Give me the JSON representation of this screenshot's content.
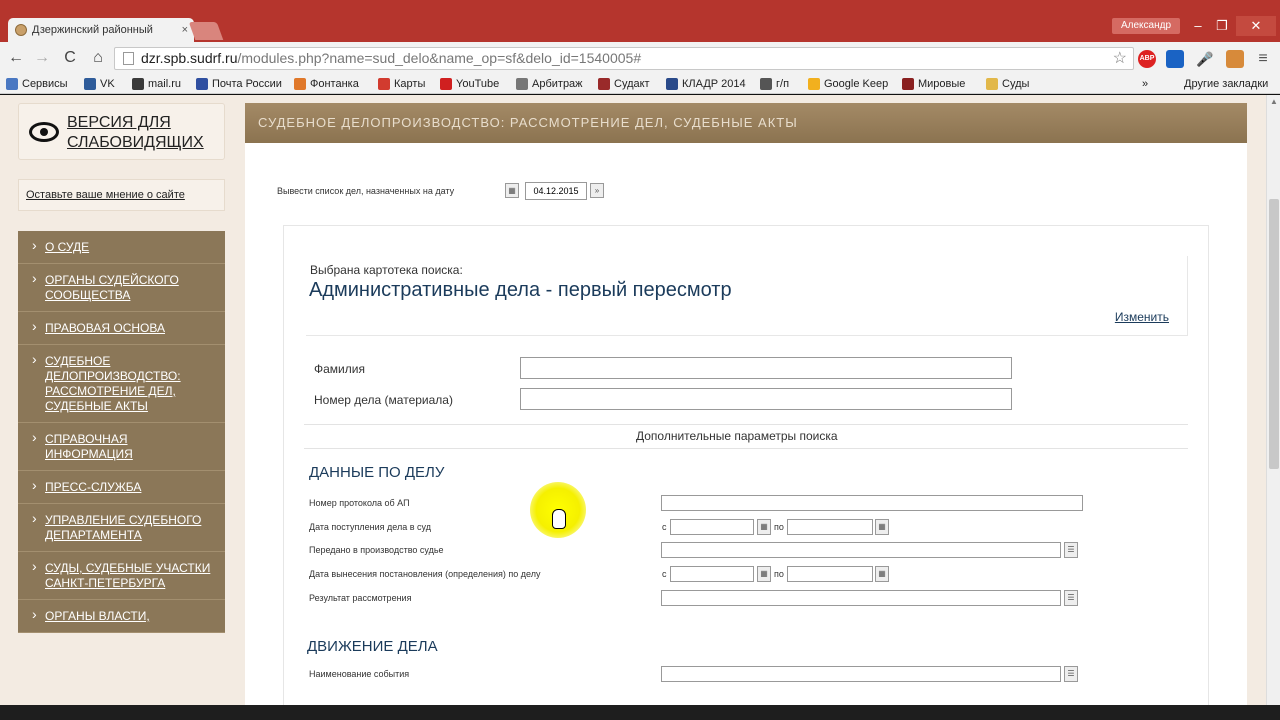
{
  "browser": {
    "tab_title": "Дзержинский районный",
    "tab_close": "×",
    "user_name": "Александр",
    "win_min": "–",
    "win_max": "❐",
    "win_close": "✕",
    "url_host": "dzr.spb.sudrf.ru",
    "url_path": "/modules.php?name=sud_delo&name_op=sf&delo_id=1540005#",
    "abp_label": "ABP",
    "nav_back": "←",
    "nav_forward": "→",
    "nav_reload": "C",
    "nav_home": "⌂",
    "star": "☆",
    "mic": "🎤",
    "menu": "≡"
  },
  "bookmarks": {
    "items": [
      "Сервисы",
      "VK",
      "mail.ru",
      "Почта России",
      "Фонтанка",
      "Карты",
      "YouTube",
      "Арбитраж",
      "Судакт",
      "КЛАДР 2014",
      "г/п",
      "Google Keep",
      "Мировые",
      "Суды"
    ],
    "overflow": "»",
    "other": "Другие закладки",
    "colors": [
      "#4a78c2",
      "#2f5c9a",
      "#3a3a3a",
      "#2f4fa0",
      "#e0782a",
      "#d23b2f",
      "#d02020",
      "#777777",
      "#9a2a2a",
      "#2a4a8a",
      "#555555",
      "#f2b01e",
      "#8a2020",
      "#e2b84a"
    ]
  },
  "sidebar": {
    "vision_label": "ВЕРСИЯ ДЛЯ СЛАБОВИДЯЩИХ",
    "opinion_link": "Оставьте ваше мнение о сайте",
    "menu": [
      "О СУДЕ",
      "ОРГАНЫ СУДЕЙСКОГО СООБЩЕСТВА",
      "ПРАВОВАЯ ОСНОВА",
      "СУДЕБНОЕ ДЕЛОПРОИЗВОДСТВО: РАССМОТРЕНИЕ ДЕЛ, СУДЕБНЫЕ АКТЫ",
      "СПРАВОЧНАЯ ИНФОРМАЦИЯ",
      "ПРЕСС-СЛУЖБА",
      "УПРАВЛЕНИЕ СУДЕБНОГО ДЕПАРТАМЕНТА",
      "СУДЫ, СУДЕБНЫЕ УЧАСТКИ САНКТ-ПЕТЕРБУРГА",
      "ОРГАНЫ ВЛАСТИ,"
    ]
  },
  "header": {
    "title": "СУДЕБНОЕ ДЕЛОПРОИЗВОДСТВО: РАССМОТРЕНИЕ ДЕЛ, СУДЕБНЫЕ АКТЫ"
  },
  "date_filter": {
    "label": "Вывести список дел, назначенных на дату",
    "date": "04.12.2015",
    "go": "»"
  },
  "search": {
    "chosen_label": "Выбрана картотека поиска:",
    "chosen_title": "Административные дела - первый пересмотр",
    "change_link": "Изменить",
    "surname_label": "Фамилия",
    "case_number_label": "Номер дела (материала)",
    "extra_params": "Дополнительные параметры поиска"
  },
  "case_data": {
    "title": "ДАННЫЕ ПО ДЕЛУ",
    "protocol_label": "Номер протокола об АП",
    "received_label": "Дата поступления дела в суд",
    "transferred_label": "Передано в производство судье",
    "decision_date_label": "Дата вынесения постановления (определения) по делу",
    "result_label": "Результат рассмотрения",
    "from": "с",
    "to": "по"
  },
  "case_movement": {
    "title": "ДВИЖЕНИЕ ДЕЛА",
    "event_label": "Наименование события"
  },
  "icons": {
    "calendar": "▦",
    "list": "☰"
  }
}
